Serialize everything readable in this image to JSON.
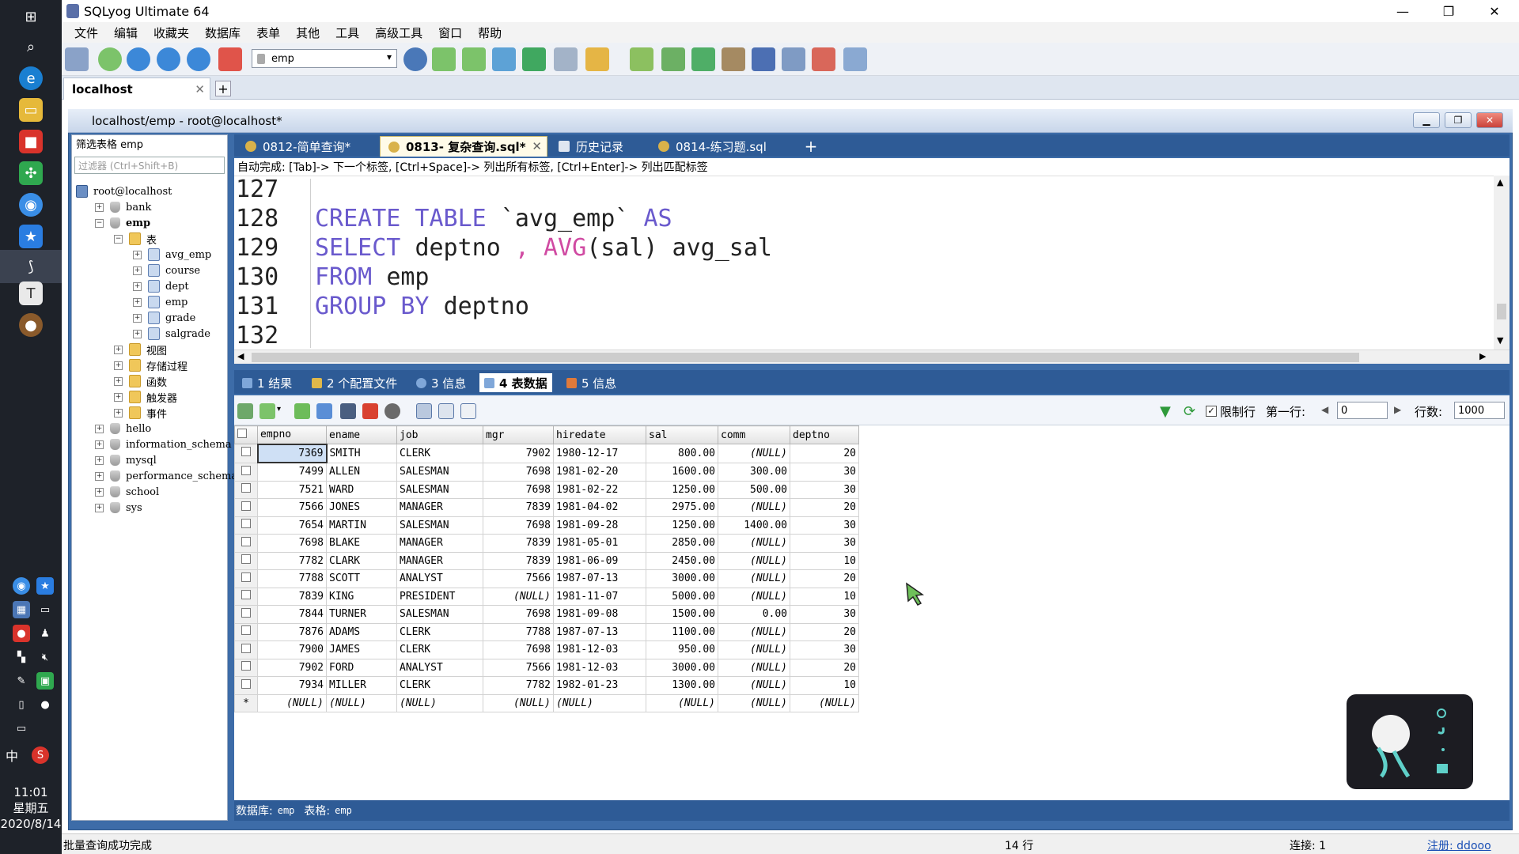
{
  "window": {
    "title": "SQLyog Ultimate 64"
  },
  "menu": [
    "文件",
    "编辑",
    "收藏夹",
    "数据库",
    "表单",
    "其他",
    "工具",
    "高级工具",
    "窗口",
    "帮助"
  ],
  "toolbar": {
    "db_select_value": "emp"
  },
  "connection_tab": {
    "label": "localhost"
  },
  "mdi": {
    "title": "localhost/emp - root@localhost*"
  },
  "object_browser": {
    "filter_label": "筛选表格 emp",
    "filter_placeholder": "过滤器 (Ctrl+Shift+B)",
    "tree": [
      {
        "label": "root@localhost",
        "level": 0,
        "icon": "server-icon",
        "toggle": ""
      },
      {
        "label": "bank",
        "level": 1,
        "icon": "database-icon",
        "toggle": "+"
      },
      {
        "label": "emp",
        "level": 1,
        "icon": "database-icon",
        "toggle": "−",
        "bold": true
      },
      {
        "label": "表",
        "level": 2,
        "icon": "folder-icon",
        "toggle": "−"
      },
      {
        "label": "avg_emp",
        "level": 3,
        "icon": "table-icon",
        "toggle": "+"
      },
      {
        "label": "course",
        "level": 3,
        "icon": "table-icon",
        "toggle": "+"
      },
      {
        "label": "dept",
        "level": 3,
        "icon": "table-icon",
        "toggle": "+"
      },
      {
        "label": "emp",
        "level": 3,
        "icon": "table-icon",
        "toggle": "+"
      },
      {
        "label": "grade",
        "level": 3,
        "icon": "table-icon",
        "toggle": "+"
      },
      {
        "label": "salgrade",
        "level": 3,
        "icon": "table-icon",
        "toggle": "+"
      },
      {
        "label": "视图",
        "level": 2,
        "icon": "folder-icon",
        "toggle": "+"
      },
      {
        "label": "存储过程",
        "level": 2,
        "icon": "folder-icon",
        "toggle": "+"
      },
      {
        "label": "函数",
        "level": 2,
        "icon": "folder-icon",
        "toggle": "+"
      },
      {
        "label": "触发器",
        "level": 2,
        "icon": "folder-icon",
        "toggle": "+"
      },
      {
        "label": "事件",
        "level": 2,
        "icon": "folder-icon",
        "toggle": "+"
      },
      {
        "label": "hello",
        "level": 1,
        "icon": "database-icon",
        "toggle": "+"
      },
      {
        "label": "information_schema",
        "level": 1,
        "icon": "database-icon",
        "toggle": "+"
      },
      {
        "label": "mysql",
        "level": 1,
        "icon": "database-icon",
        "toggle": "+"
      },
      {
        "label": "performance_schema",
        "level": 1,
        "icon": "database-icon",
        "toggle": "+"
      },
      {
        "label": "school",
        "level": 1,
        "icon": "database-icon",
        "toggle": "+"
      },
      {
        "label": "sys",
        "level": 1,
        "icon": "database-icon",
        "toggle": "+"
      }
    ]
  },
  "editor_tabs": [
    {
      "label": "0812-简单查询*",
      "active": false
    },
    {
      "label": "0813- 复杂查询.sql*",
      "active": true
    },
    {
      "label": "历史记录",
      "active": false
    },
    {
      "label": "0814-练习题.sql",
      "active": false
    }
  ],
  "autocomplete_hint": "自动完成: [Tab]-> 下一个标签, [Ctrl+Space]-> 列出所有标签, [Ctrl+Enter]-> 列出匹配标签",
  "code_lines": [
    {
      "num": "127",
      "tokens": []
    },
    {
      "num": "128",
      "tokens": [
        [
          "kw",
          "CREATE TABLE "
        ],
        [
          "id",
          "`avg_emp` "
        ],
        [
          "kw",
          "AS"
        ]
      ]
    },
    {
      "num": "129",
      "tokens": [
        [
          "kw",
          "SELECT "
        ],
        [
          "id",
          "deptno "
        ],
        [
          "op",
          ", "
        ],
        [
          "fn",
          "AVG"
        ],
        [
          "id",
          "(sal) avg_sal"
        ]
      ]
    },
    {
      "num": "130",
      "tokens": [
        [
          "kw",
          "FROM "
        ],
        [
          "id",
          "emp"
        ]
      ]
    },
    {
      "num": "131",
      "tokens": [
        [
          "kw",
          "GROUP BY "
        ],
        [
          "id",
          "deptno"
        ]
      ]
    },
    {
      "num": "132",
      "tokens": []
    }
  ],
  "result_tabs": [
    {
      "label": "1 结果",
      "active": false
    },
    {
      "label": "2 个配置文件",
      "active": false
    },
    {
      "label": "3 信息",
      "active": false
    },
    {
      "label": "4 表数据",
      "active": true
    },
    {
      "label": "5 信息",
      "active": false
    }
  ],
  "result_toolbar": {
    "limit_label": "限制行",
    "first_row_label": "第一行:",
    "first_row_value": "0",
    "rows_label": "行数:",
    "rows_value": "1000"
  },
  "grid": {
    "columns": [
      "empno",
      "ename",
      "job",
      "mgr",
      "hiredate",
      "sal",
      "comm",
      "deptno"
    ],
    "rows": [
      [
        "7369",
        "SMITH",
        "CLERK",
        "7902",
        "1980-12-17",
        "800.00",
        "(NULL)",
        "20"
      ],
      [
        "7499",
        "ALLEN",
        "SALESMAN",
        "7698",
        "1981-02-20",
        "1600.00",
        "300.00",
        "30"
      ],
      [
        "7521",
        "WARD",
        "SALESMAN",
        "7698",
        "1981-02-22",
        "1250.00",
        "500.00",
        "30"
      ],
      [
        "7566",
        "JONES",
        "MANAGER",
        "7839",
        "1981-04-02",
        "2975.00",
        "(NULL)",
        "20"
      ],
      [
        "7654",
        "MARTIN",
        "SALESMAN",
        "7698",
        "1981-09-28",
        "1250.00",
        "1400.00",
        "30"
      ],
      [
        "7698",
        "BLAKE",
        "MANAGER",
        "7839",
        "1981-05-01",
        "2850.00",
        "(NULL)",
        "30"
      ],
      [
        "7782",
        "CLARK",
        "MANAGER",
        "7839",
        "1981-06-09",
        "2450.00",
        "(NULL)",
        "10"
      ],
      [
        "7788",
        "SCOTT",
        "ANALYST",
        "7566",
        "1987-07-13",
        "3000.00",
        "(NULL)",
        "20"
      ],
      [
        "7839",
        "KING",
        "PRESIDENT",
        "(NULL)",
        "1981-11-07",
        "5000.00",
        "(NULL)",
        "10"
      ],
      [
        "7844",
        "TURNER",
        "SALESMAN",
        "7698",
        "1981-09-08",
        "1500.00",
        "0.00",
        "30"
      ],
      [
        "7876",
        "ADAMS",
        "CLERK",
        "7788",
        "1987-07-13",
        "1100.00",
        "(NULL)",
        "20"
      ],
      [
        "7900",
        "JAMES",
        "CLERK",
        "7698",
        "1981-12-03",
        "950.00",
        "(NULL)",
        "30"
      ],
      [
        "7902",
        "FORD",
        "ANALYST",
        "7566",
        "1981-12-03",
        "3000.00",
        "(NULL)",
        "20"
      ],
      [
        "7934",
        "MILLER",
        "CLERK",
        "7782",
        "1982-01-23",
        "1300.00",
        "(NULL)",
        "10"
      ],
      [
        "(NULL)",
        "(NULL)",
        "(NULL)",
        "(NULL)",
        "(NULL)",
        "(NULL)",
        "(NULL)",
        "(NULL)"
      ]
    ],
    "new_row_marker": "*"
  },
  "grid_status": {
    "db_label": "数据库:",
    "db_value": "emp",
    "table_label": "表格:",
    "table_value": "emp"
  },
  "statusbar": {
    "message": "批量查询成功完成",
    "rows": "14 行",
    "connections": "连接: 1",
    "register": "注册: ddooo"
  },
  "taskbar": {
    "time": "11:01",
    "weekday": "星期五",
    "date": "2020/8/14",
    "ime": "中"
  }
}
